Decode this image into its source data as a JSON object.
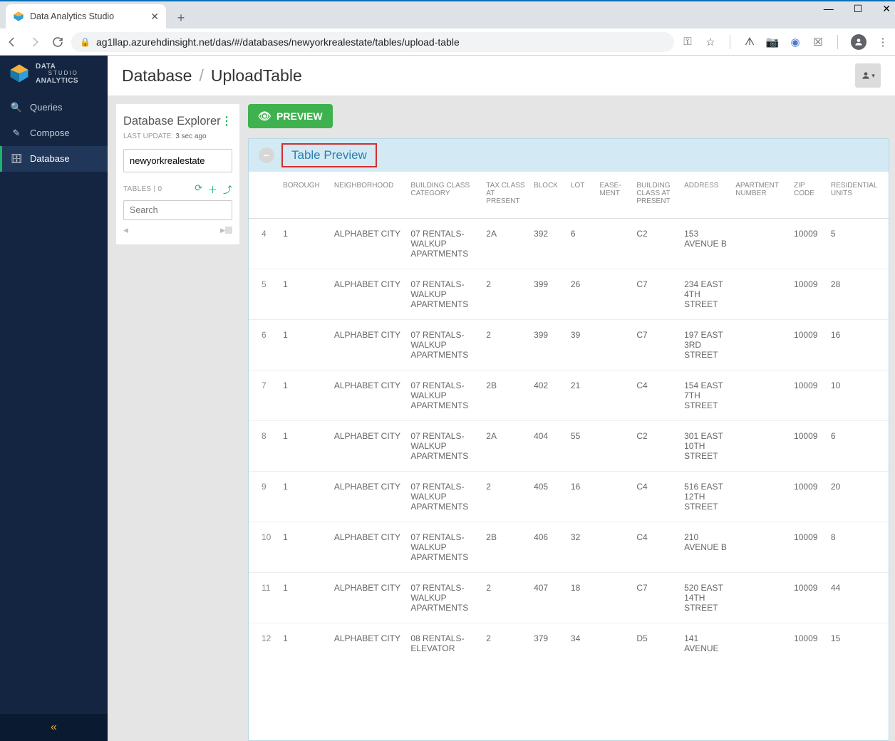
{
  "window": {
    "tab_title": "Data Analytics Studio",
    "url": "ag1llap.azurehdinsight.net/das/#/databases/newyorkrealestate/tables/upload-table"
  },
  "sidebar": {
    "brand_l1": "DATA",
    "brand_l2": "STUDIO",
    "brand_l3": "ANALYTICS",
    "items": [
      {
        "icon": "🔍",
        "label": "Queries"
      },
      {
        "icon": "✎",
        "label": "Compose"
      },
      {
        "icon": "🗄",
        "label": "Database"
      }
    ]
  },
  "breadcrumb": {
    "part1": "Database",
    "part2": "UploadTable"
  },
  "explorer": {
    "title": "Database Explorer",
    "last_update_label": "LAST UPDATE:",
    "last_update_value": "3 sec ago",
    "db_name": "newyorkrealestate",
    "tables_label": "TABLES  |  0",
    "search_placeholder": "Search"
  },
  "preview_button": "PREVIEW",
  "panel_title": "Table Preview",
  "columns": [
    "",
    "BOROUGH",
    "NEIGHBORHOOD",
    "BUILDING CLASS CATEGORY",
    "TAX CLASS AT PRESENT",
    "BLOCK",
    "LOT",
    "EASE-MENT",
    "BUILDING CLASS AT PRESENT",
    "ADDRESS",
    "APARTMENT NUMBER",
    "ZIP CODE",
    "RESIDENTIAL UNITS"
  ],
  "rows": [
    [
      "4",
      "1",
      "ALPHABET CITY",
      "07 RENTALS- WALKUP APARTMENTS",
      "2A",
      "392",
      "6",
      "",
      "C2",
      "153 AVENUE B",
      "",
      "10009",
      "5"
    ],
    [
      "5",
      "1",
      "ALPHABET CITY",
      "07 RENTALS- WALKUP APARTMENTS",
      "2",
      "399",
      "26",
      "",
      "C7",
      "234 EAST 4TH STREET",
      "",
      "10009",
      "28"
    ],
    [
      "6",
      "1",
      "ALPHABET CITY",
      "07 RENTALS- WALKUP APARTMENTS",
      "2",
      "399",
      "39",
      "",
      "C7",
      "197 EAST 3RD STREET",
      "",
      "10009",
      "16"
    ],
    [
      "7",
      "1",
      "ALPHABET CITY",
      "07 RENTALS- WALKUP APARTMENTS",
      "2B",
      "402",
      "21",
      "",
      "C4",
      "154 EAST 7TH STREET",
      "",
      "10009",
      "10"
    ],
    [
      "8",
      "1",
      "ALPHABET CITY",
      "07 RENTALS- WALKUP APARTMENTS",
      "2A",
      "404",
      "55",
      "",
      "C2",
      "301 EAST 10TH STREET",
      "",
      "10009",
      "6"
    ],
    [
      "9",
      "1",
      "ALPHABET CITY",
      "07 RENTALS- WALKUP APARTMENTS",
      "2",
      "405",
      "16",
      "",
      "C4",
      "516 EAST 12TH STREET",
      "",
      "10009",
      "20"
    ],
    [
      "10",
      "1",
      "ALPHABET CITY",
      "07 RENTALS- WALKUP APARTMENTS",
      "2B",
      "406",
      "32",
      "",
      "C4",
      "210 AVENUE B",
      "",
      "10009",
      "8"
    ],
    [
      "11",
      "1",
      "ALPHABET CITY",
      "07 RENTALS- WALKUP APARTMENTS",
      "2",
      "407",
      "18",
      "",
      "C7",
      "520 EAST 14TH STREET",
      "",
      "10009",
      "44"
    ],
    [
      "12",
      "1",
      "ALPHABET CITY",
      "08 RENTALS- ELEVATOR",
      "2",
      "379",
      "34",
      "",
      "D5",
      "141 AVENUE",
      "",
      "10009",
      "15"
    ]
  ]
}
